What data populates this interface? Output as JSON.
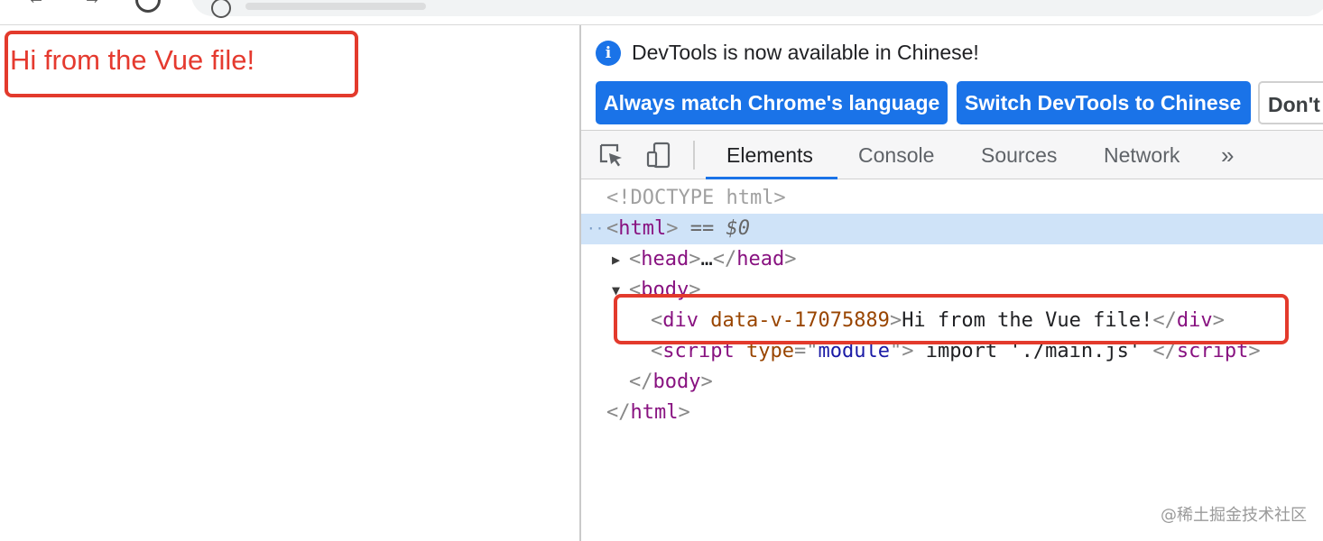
{
  "browser": {
    "page_text": "Hi from the Vue file!"
  },
  "devtools": {
    "infobar": {
      "message": "DevTools is now available in Chinese!",
      "btn_match": "Always match Chrome's language",
      "btn_switch": "Switch DevTools to Chinese",
      "btn_dont": "Don't"
    },
    "tabs": [
      "Elements",
      "Console",
      "Sources",
      "Network"
    ],
    "more_tabs": "»",
    "dom": {
      "doctype": "<!DOCTYPE html>",
      "html_open": "html",
      "selected_marker": "== $0",
      "head": "head",
      "ellipsis": "…",
      "body": "body",
      "div_tag": "div",
      "div_attr": "data-v-17075889",
      "div_text": "Hi from the Vue file!",
      "script_tag": "script",
      "script_attr": "type",
      "script_val": "module",
      "script_text": " import './main.js' "
    }
  },
  "watermark": "@稀土掘金技术社区",
  "colors": {
    "highlight_red": "#e33a2c",
    "devtools_blue": "#1a73e8",
    "selected_row": "#cfe3f8"
  }
}
